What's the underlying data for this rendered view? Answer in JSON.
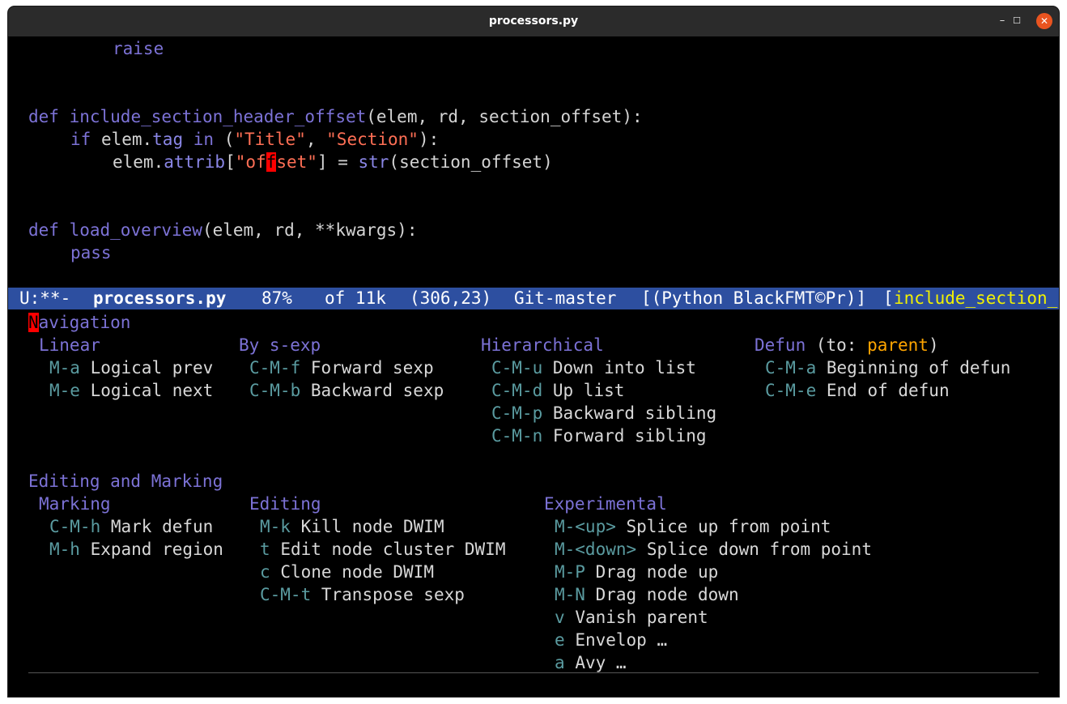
{
  "window": {
    "title": "processors.py",
    "controls": {
      "minimize": "–",
      "maximize": "☐",
      "close": "✕"
    }
  },
  "code": {
    "l1": "raise",
    "l2_def": "def",
    "l2_name": "include_section_header_offset",
    "l2_args": "(elem, rd, section_offset):",
    "l3_if": "if",
    "l3_a": " elem.",
    "l3_attr": "tag",
    "l3_in": "in",
    "l3_p1": " (",
    "l3_s1": "\"Title\"",
    "l3_c": ", ",
    "l3_s2": "\"Section\"",
    "l3_p2": "):",
    "l4_a": "elem.",
    "l4_attr": "attrib",
    "l4_b": "[",
    "l4_s1": "\"of",
    "l4_cur": "f",
    "l4_s2": "set\"",
    "l4_c": "] = ",
    "l4_fn": "str",
    "l4_d": "(section_offset)",
    "l5_def": "def",
    "l5_name": "load_overview",
    "l5_args": "(elem, rd, **kwargs):",
    "l6": "pass"
  },
  "modeline": {
    "status": "U:**-",
    "file": "processors.py",
    "percent": "87%",
    "size": "of 11k",
    "pos": "(306,23)",
    "vc": "Git-master",
    "mode": "[(Python BlackFMT©Pr)]",
    "which_open": "[",
    "which": "include_section_"
  },
  "menu": {
    "nav_cursor": "N",
    "nav_rest": "avigation",
    "linear": {
      "title": "Linear",
      "items": [
        {
          "key": "M-a",
          "desc": "Logical prev"
        },
        {
          "key": "M-e",
          "desc": "Logical next"
        }
      ]
    },
    "sexp": {
      "title": "By s-exp",
      "items": [
        {
          "key": "C-M-f",
          "desc": "Forward sexp"
        },
        {
          "key": "C-M-b",
          "desc": "Backward sexp"
        }
      ]
    },
    "hier": {
      "title": "Hierarchical",
      "items": [
        {
          "key": "C-M-u",
          "desc": "Down into list"
        },
        {
          "key": "C-M-d",
          "desc": "Up list"
        },
        {
          "key": "C-M-p",
          "desc": "Backward sibling"
        },
        {
          "key": "C-M-n",
          "desc": "Forward sibling"
        }
      ]
    },
    "defun": {
      "title": "Defun",
      "to_open": " (to: ",
      "to_val": "parent",
      "to_close": ")",
      "items": [
        {
          "key": "C-M-a",
          "desc": "Beginning of defun"
        },
        {
          "key": "C-M-e",
          "desc": "End of defun"
        }
      ]
    },
    "editing_title": "Editing and Marking",
    "marking": {
      "title": "Marking",
      "items": [
        {
          "key": "C-M-h",
          "desc": "Mark defun"
        },
        {
          "key": "M-h",
          "desc": "Expand region"
        }
      ]
    },
    "editing": {
      "title": "Editing",
      "items": [
        {
          "key": "M-k",
          "desc": "Kill node DWIM"
        },
        {
          "key": "t",
          "desc": "Edit node cluster DWIM"
        },
        {
          "key": "c",
          "desc": "Clone node DWIM"
        },
        {
          "key": "C-M-t",
          "desc": "Transpose sexp"
        }
      ]
    },
    "experimental": {
      "title": "Experimental",
      "items": [
        {
          "key": "M-<up>",
          "desc": "Splice up from point"
        },
        {
          "key": "M-<down>",
          "desc": "Splice down from point"
        },
        {
          "key": "M-P",
          "desc": "Drag node up"
        },
        {
          "key": "M-N",
          "desc": "Drag node down"
        },
        {
          "key": "v",
          "desc": "Vanish parent"
        },
        {
          "key": "e",
          "desc": "Envelop …"
        },
        {
          "key": "a",
          "desc": "Avy …"
        }
      ]
    }
  },
  "colors": {
    "keyword": "#7c72d6",
    "string": "#ff6f55",
    "modeline_bg": "#2d4fa0",
    "key": "#5a9ba0",
    "cursor": "#ff0000",
    "highlight": "#f2f200"
  }
}
